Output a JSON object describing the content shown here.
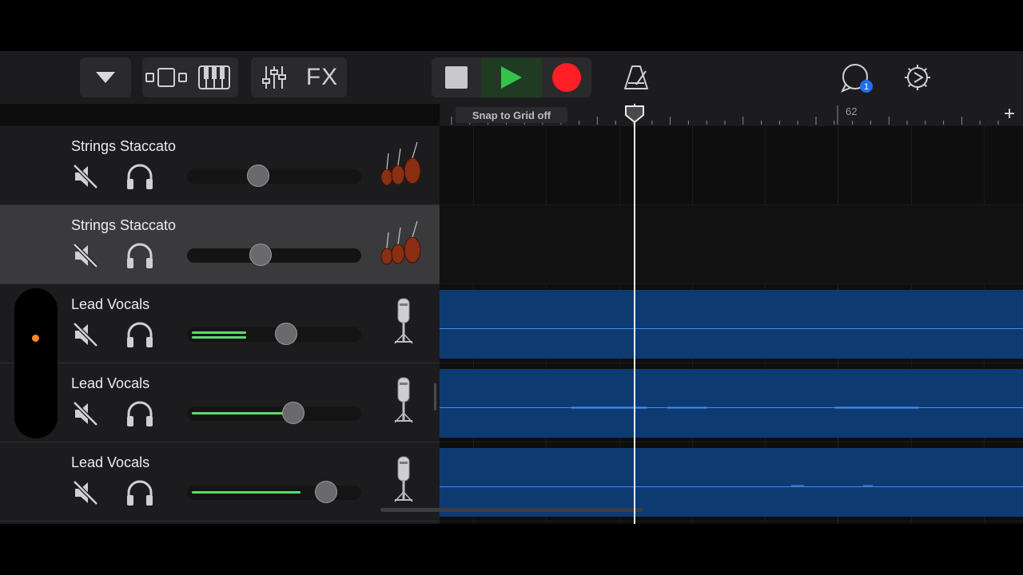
{
  "toolbar": {
    "dropdown_icon": "triangle-down-icon",
    "view_buttons": [
      {
        "icon": "tracks-view-icon"
      },
      {
        "icon": "keyboard-icon"
      }
    ],
    "mixer_icon": "mixer-sliders-icon",
    "fx_label": "FX",
    "transport": {
      "stop_icon": "stop-icon",
      "play_icon": "play-icon",
      "record_icon": "record-icon"
    },
    "metronome_icon": "metronome-icon",
    "loop_icon": "loop-browser-icon",
    "loop_badge": "1",
    "settings_icon": "settings-gear-icon"
  },
  "ruler": {
    "snap_label": "Snap to Grid off",
    "bar_number": "62",
    "add_label": "+"
  },
  "tracks": [
    {
      "name": "Strings Staccato",
      "instrument_icon": "strings-icon",
      "volume": 0.41,
      "meter": 0,
      "selected": false
    },
    {
      "name": "Strings Staccato",
      "instrument_icon": "strings-icon",
      "volume": 0.42,
      "meter": 0,
      "selected": true
    },
    {
      "name": "Lead Vocals",
      "instrument_icon": "microphone-icon",
      "volume": 0.57,
      "meter": 0.33,
      "selected": false
    },
    {
      "name": "Lead Vocals",
      "instrument_icon": "microphone-icon",
      "volume": 0.61,
      "meter": 0.61,
      "selected": false
    },
    {
      "name": "Lead Vocals",
      "instrument_icon": "microphone-icon",
      "volume": 0.8,
      "meter": 0.66,
      "selected": false
    }
  ],
  "colors": {
    "record": "#ff1f24",
    "play": "#34c34a",
    "region": "#0e3a72",
    "waveform": "#3d8ef0",
    "meter": "#5fd86c",
    "selection_dot": "#ff8a1f",
    "badge": "#1e6ff2"
  }
}
